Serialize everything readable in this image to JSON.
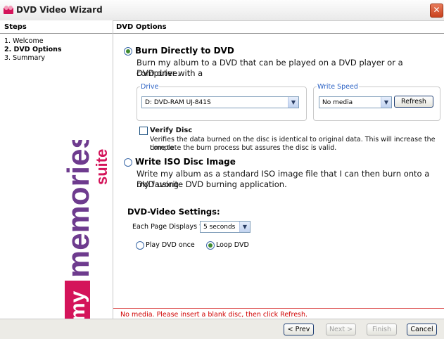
{
  "window": {
    "title": "DVD Video Wizard",
    "close_glyph": "✕"
  },
  "steps": {
    "header": "Steps",
    "items": [
      {
        "label": "1. Welcome"
      },
      {
        "label": "2. DVD Options"
      },
      {
        "label": "3. Summary"
      }
    ]
  },
  "logo": {
    "brand": "mymemories",
    "suffix": "suite",
    "prefix": "my",
    "word": "memories"
  },
  "main": {
    "header": "DVD Options",
    "burn": {
      "title": "Burn Directly to DVD",
      "description_line1": "Burn my album to a DVD that can be played on a DVD player or a computer with a",
      "description_line2": "DVD drive.",
      "selected": true
    },
    "drive": {
      "legend": "Drive",
      "value": "D: DVD-RAM UJ-841S"
    },
    "write_speed": {
      "legend": "Write Speed",
      "value": "No media",
      "refresh_label": "Refresh"
    },
    "verify": {
      "title": "Verify Disc",
      "checked": false,
      "description_line1": "Verifies the data burned on the disc is identical to original data. This will increase the time to",
      "description_line2": "complete the burn process but assures the disc is valid."
    },
    "iso": {
      "title": "Write ISO Disc Image",
      "description_line1": "Write my album as a standard ISO image file that I can then burn onto a DVD using",
      "description_line2": "my favorite DVD burning application.",
      "selected": false
    },
    "dvd_settings": {
      "title": "DVD-Video Settings:",
      "page_display_label": "Each Page Displays for:",
      "page_display_value": "5 seconds",
      "play_once_label": "Play DVD once",
      "loop_label": "Loop DVD",
      "loop_selected": true
    },
    "error_message": "No media. Please insert a blank disc, then click Refresh."
  },
  "footer": {
    "prev_label": "< Prev",
    "next_label": "Next >",
    "finish_label": "Finish",
    "cancel_label": "Cancel"
  },
  "colors": {
    "error": "#d00000",
    "legend": "#2c62c4",
    "logo_purple": "#6e3b8e",
    "logo_red": "#d4145a"
  }
}
